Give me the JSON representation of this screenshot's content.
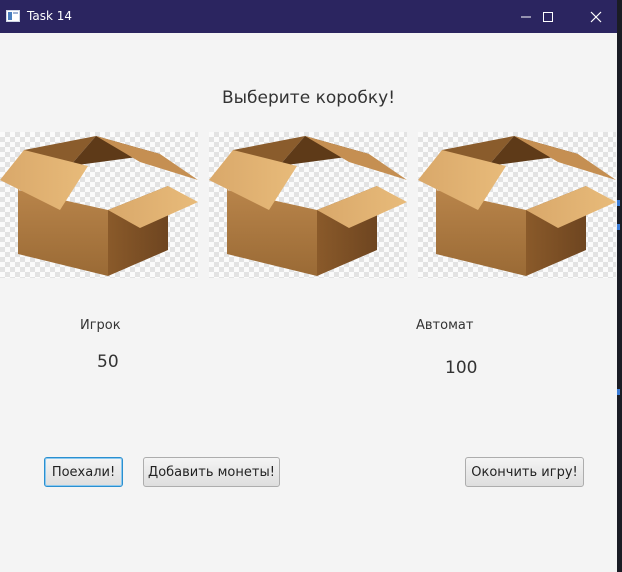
{
  "window": {
    "title": "Task 14",
    "controls": [
      "minimize-icon",
      "maximize-icon",
      "close-icon"
    ]
  },
  "main": {
    "heading": "Выберите коробку!",
    "boxes": [
      {
        "name": "box-1"
      },
      {
        "name": "box-2"
      },
      {
        "name": "box-3"
      }
    ],
    "player": {
      "label": "Игрок",
      "score": "50"
    },
    "machine": {
      "label": "Автомат",
      "score": "100"
    }
  },
  "buttons": {
    "go": "Поехали!",
    "add_coins": "Добавить монеты!",
    "end_game": "Окончить игру!"
  },
  "colors": {
    "titlebar": "#2b2560",
    "window_bg": "#f4f4f4",
    "focus": "#2a8fd0"
  }
}
